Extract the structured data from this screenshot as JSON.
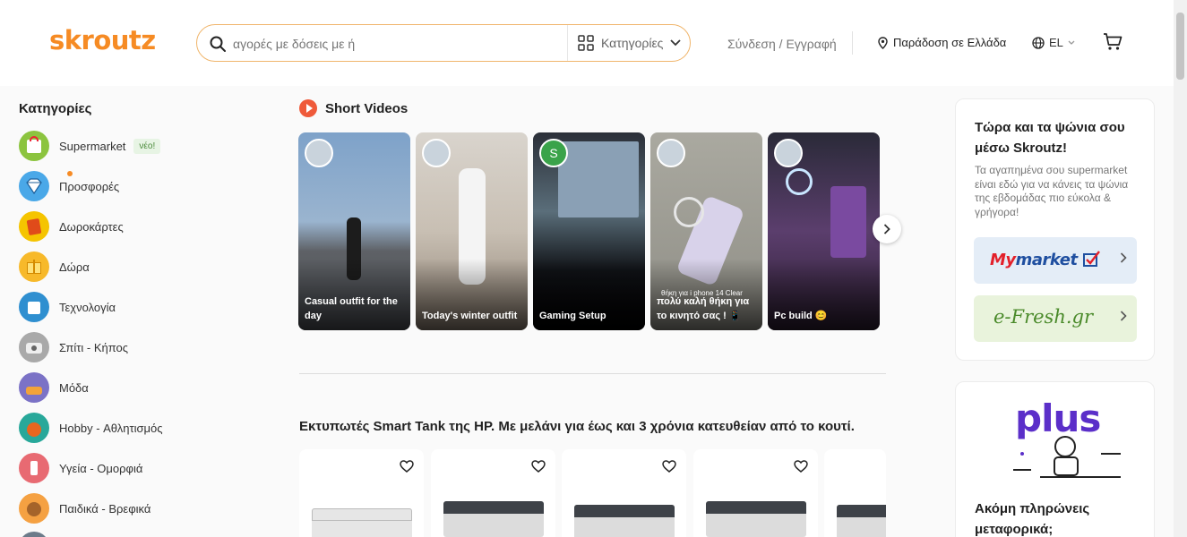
{
  "header": {
    "logo": "skroutz",
    "search_placeholder": "αγορές με δόσεις με ή",
    "categories_label": "Κατηγορίες",
    "login_label": "Σύνδεση / Εγγραφή",
    "delivery_label": "Παράδοση σε Ελλάδα",
    "language_label": "EL"
  },
  "sidebar": {
    "title": "Κατηγορίες",
    "new_badge": "νέο!",
    "items": [
      {
        "label": "Supermarket",
        "color": "#8cc43f",
        "icon": "supermarket-icon"
      },
      {
        "label": "Προσφορές",
        "color": "#4aa8e8",
        "icon": "diamond-icon"
      },
      {
        "label": "Δωροκάρτες",
        "color": "#f5c400",
        "icon": "gift-card-icon"
      },
      {
        "label": "Δώρα",
        "color": "#f7b92a",
        "icon": "gift-icon"
      },
      {
        "label": "Τεχνολογία",
        "color": "#2f8fd0",
        "icon": "technology-icon"
      },
      {
        "label": "Σπίτι - Κήπος",
        "color": "#a9a9a9",
        "icon": "home-garden-icon"
      },
      {
        "label": "Μόδα",
        "color": "#7b72c6",
        "icon": "fashion-icon"
      },
      {
        "label": "Hobby - Αθλητισμός",
        "color": "#28a89a",
        "icon": "sports-icon"
      },
      {
        "label": "Υγεία - Ομορφιά",
        "color": "#e86a72",
        "icon": "beauty-icon"
      },
      {
        "label": "Παιδικά - Βρεφικά",
        "color": "#f5a142",
        "icon": "kids-icon"
      }
    ]
  },
  "short_videos": {
    "title": "Short Videos",
    "videos": [
      {
        "caption": "Casual outfit for the day",
        "bg": "#6f8fb5"
      },
      {
        "caption": "Today's winter outfit",
        "bg": "#b7a99a"
      },
      {
        "caption": "Gaming Setup",
        "bg": "#3b3f4a",
        "avatar_letter": "S"
      },
      {
        "caption": "πολύ καλή θήκη για το κινητό σας ! 📱",
        "overlay": "θήκη για i phone 14 Clear",
        "bg": "#9d9d93"
      },
      {
        "caption": "Pc build 😊",
        "bg": "#4a3650"
      }
    ]
  },
  "promo": {
    "title": "Εκτυπωτές Smart Tank της HP. Με μελάνι για έως και 3 χρόνια κατευθείαν από το κουτί."
  },
  "right": {
    "card1_title": "Τώρα και τα ψώνια σου μέσω Skroutz!",
    "card1_text": "Τα αγαπημένα σου supermarket είναι εδώ για να κάνεις τα ψώνια της εβδομάδας πιο εύκολα & γρήγορα!",
    "store1": "Mymarket",
    "store2": "e-Fresh.gr",
    "card2_logo": "plus",
    "card2_title": "Ακόμη πληρώνεις μεταφορικά;"
  },
  "colors": {
    "brand": "#f68b24",
    "plus": "#5b2fc9"
  }
}
